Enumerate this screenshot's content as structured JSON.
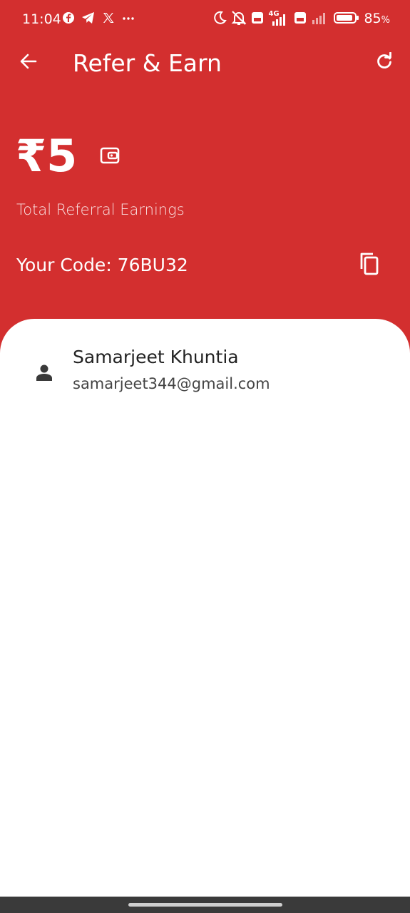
{
  "status_bar": {
    "time": "11:04",
    "left_icons": [
      "facebook-icon",
      "telegram-icon",
      "x-icon",
      "more-dots-icon"
    ],
    "right_icons": [
      "moon-icon",
      "bell-off-icon",
      "volte-icon",
      "signal-4g-icon",
      "volte-icon",
      "signal-icon",
      "battery-icon"
    ],
    "network_label": "4G",
    "battery_text": "85",
    "battery_pct": "%"
  },
  "app_bar": {
    "title": "Refer & Earn"
  },
  "earnings": {
    "amount": "₹5",
    "label": "Total Referral Earnings"
  },
  "code": {
    "text": "Your Code: 76BU32"
  },
  "referrals": [
    {
      "name": "Samarjeet Khuntia",
      "email": "samarjeet344@gmail.com"
    }
  ],
  "colors": {
    "primary": "#d32f2f",
    "background": "#ffffff",
    "icon_dark": "#3a3a3a"
  }
}
